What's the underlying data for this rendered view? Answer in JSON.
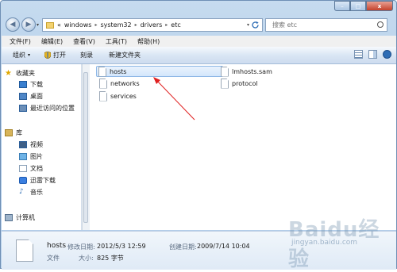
{
  "window": {
    "controls": {
      "minimize": "–",
      "maximize": "□",
      "close": "x"
    }
  },
  "nav": {
    "back": "◀",
    "forward": "▶",
    "dropdown": "▾"
  },
  "address": {
    "prefix": "«",
    "segments": [
      "windows",
      "system32",
      "drivers",
      "etc"
    ],
    "separator": "▸",
    "dropdown": "▾"
  },
  "search": {
    "placeholder": "搜索 etc"
  },
  "menu": {
    "items": [
      "文件(F)",
      "编辑(E)",
      "查看(V)",
      "工具(T)",
      "帮助(H)"
    ]
  },
  "toolbar": {
    "organize": "组织",
    "organize_arrow": "▾",
    "open": "打开",
    "burn": "刻录",
    "new_folder": "新建文件夹"
  },
  "navpane": {
    "favorites": "收藏夹",
    "downloads": "下载",
    "desktop": "桌面",
    "recent": "最近访问的位置",
    "library": "库",
    "videos": "视频",
    "pictures": "图片",
    "documents": "文档",
    "xunlei": "迅雷下载",
    "music": "音乐",
    "computer": "计算机"
  },
  "files": {
    "col1": [
      "hosts",
      "networks",
      "services"
    ],
    "col2": [
      "lmhosts.sam",
      "protocol"
    ]
  },
  "details": {
    "name": "hosts",
    "type": "文件",
    "modified_label": "修改日期:",
    "modified_value": "2012/5/3 12:59",
    "created_label": "创建日期:",
    "created_value": "2009/7/14 10:04",
    "size_label": "大小:",
    "size_value": "825 字节"
  },
  "watermark": {
    "logo": "Baidu经验",
    "url": "jingyan.baidu.com"
  },
  "colors": {
    "accent": "#2e6db5",
    "arrow": "#e02020",
    "selection": "#d3e6fb"
  }
}
